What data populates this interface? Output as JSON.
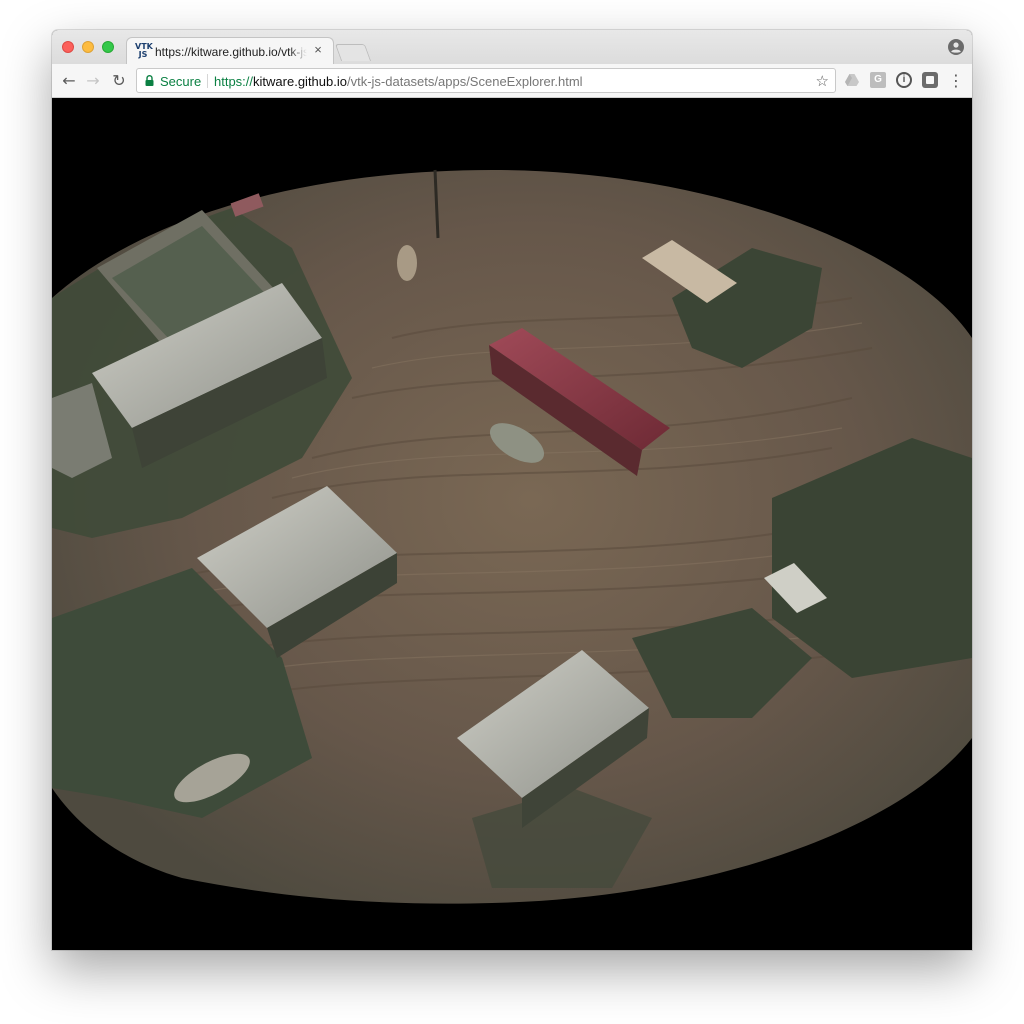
{
  "tab": {
    "title": "https://kitware.github.io/vtk-js",
    "favicon_text": "VTK JS",
    "close_symbol": "×"
  },
  "toolbar": {
    "back_symbol": "←",
    "forward_symbol": "→",
    "reload_symbol": "↻",
    "secure_label": "Secure",
    "url_scheme": "https://",
    "url_host": "kitware.github.io",
    "url_path": "/vtk-js-datasets/apps/SceneExplorer.html",
    "bookmark_symbol": "☆",
    "menu_symbol": "⋮"
  },
  "extensions": {
    "g_label": "G",
    "info_label": "i"
  },
  "scene": {
    "description_icon": "3d-terrain-scene",
    "background_color": "#000000",
    "ground_color": "#6b5a48"
  }
}
